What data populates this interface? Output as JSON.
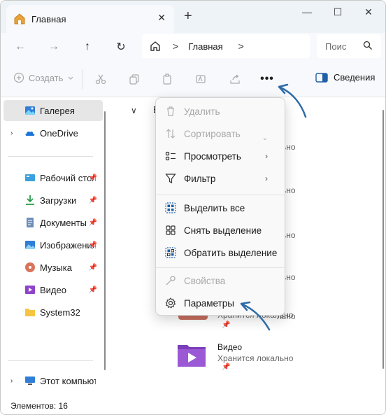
{
  "window": {
    "tab_title": "Главная",
    "close_tab_glyph": "✕",
    "new_tab_glyph": "+",
    "minimize_glyph": "—",
    "maximize_glyph": "☐",
    "close_glyph": "✕"
  },
  "address": {
    "back_glyph": "←",
    "forward_glyph": "→",
    "up_glyph": "↑",
    "refresh_glyph": "↻",
    "path_separator": ">",
    "path_label": "Главная",
    "search_placeholder": "Поис"
  },
  "toolbar": {
    "create_label": "Создать",
    "more_glyph": "•••",
    "details_label": "Сведения"
  },
  "sidebar": {
    "items": [
      {
        "label": "Галерея",
        "icon": "gallery-icon",
        "selected": true,
        "pinned": false,
        "expandable": false
      },
      {
        "label": "OneDrive",
        "icon": "onedrive-icon",
        "selected": false,
        "pinned": false,
        "expandable": true
      },
      {
        "label": "Рабочий стол",
        "icon": "desktop-icon",
        "selected": false,
        "pinned": true,
        "expandable": false
      },
      {
        "label": "Загрузки",
        "icon": "downloads-icon",
        "selected": false,
        "pinned": true,
        "expandable": false
      },
      {
        "label": "Документы",
        "icon": "documents-icon",
        "selected": false,
        "pinned": true,
        "expandable": false
      },
      {
        "label": "Изображения",
        "icon": "pictures-icon",
        "selected": false,
        "pinned": true,
        "expandable": false
      },
      {
        "label": "Музыка",
        "icon": "music-icon",
        "selected": false,
        "pinned": true,
        "expandable": false
      },
      {
        "label": "Видео",
        "icon": "videos-icon",
        "selected": false,
        "pinned": true,
        "expandable": false
      },
      {
        "label": "System32",
        "icon": "folder-icon",
        "selected": false,
        "pinned": false,
        "expandable": false
      },
      {
        "label": "Этот компьютер",
        "icon": "this-pc-icon",
        "selected": false,
        "pinned": false,
        "expandable": true
      }
    ],
    "pin_glyph": "📌"
  },
  "main": {
    "group_chevron": "∨",
    "group_label_partial": "Б",
    "partial_texts": [
      "льно",
      "льно",
      "льно",
      "льно",
      "льно"
    ],
    "video_card": {
      "name": "Видео",
      "status": "Хранится локально"
    },
    "music_card_status_partial": "Хранится локально"
  },
  "menu": {
    "items": [
      {
        "label": "Удалить",
        "icon": "trash-icon",
        "disabled": true,
        "submenu": false
      },
      {
        "label": "Сортировать",
        "icon": "sort-icon",
        "disabled": true,
        "submenu": false
      },
      {
        "label": "Просмотреть",
        "icon": "view-icon",
        "disabled": false,
        "submenu": true
      },
      {
        "label": "Фильтр",
        "icon": "filter-icon",
        "disabled": false,
        "submenu": true
      },
      {
        "label": "Выделить все",
        "icon": "select-all-icon",
        "disabled": false,
        "submenu": false
      },
      {
        "label": "Снять выделение",
        "icon": "select-none-icon",
        "disabled": false,
        "submenu": false
      },
      {
        "label": "Обратить выделение",
        "icon": "invert-selection-icon",
        "disabled": false,
        "submenu": false
      },
      {
        "label": "Свойства",
        "icon": "properties-icon",
        "disabled": true,
        "submenu": false
      },
      {
        "label": "Параметры",
        "icon": "options-icon",
        "disabled": false,
        "submenu": false
      }
    ],
    "submenu_glyph": "›"
  },
  "status": {
    "items_count": "Элементов: 16"
  },
  "colors": {
    "accent": "#1f5fa8",
    "arrow": "#2e6ba8",
    "chrome": "#eef3f8"
  }
}
